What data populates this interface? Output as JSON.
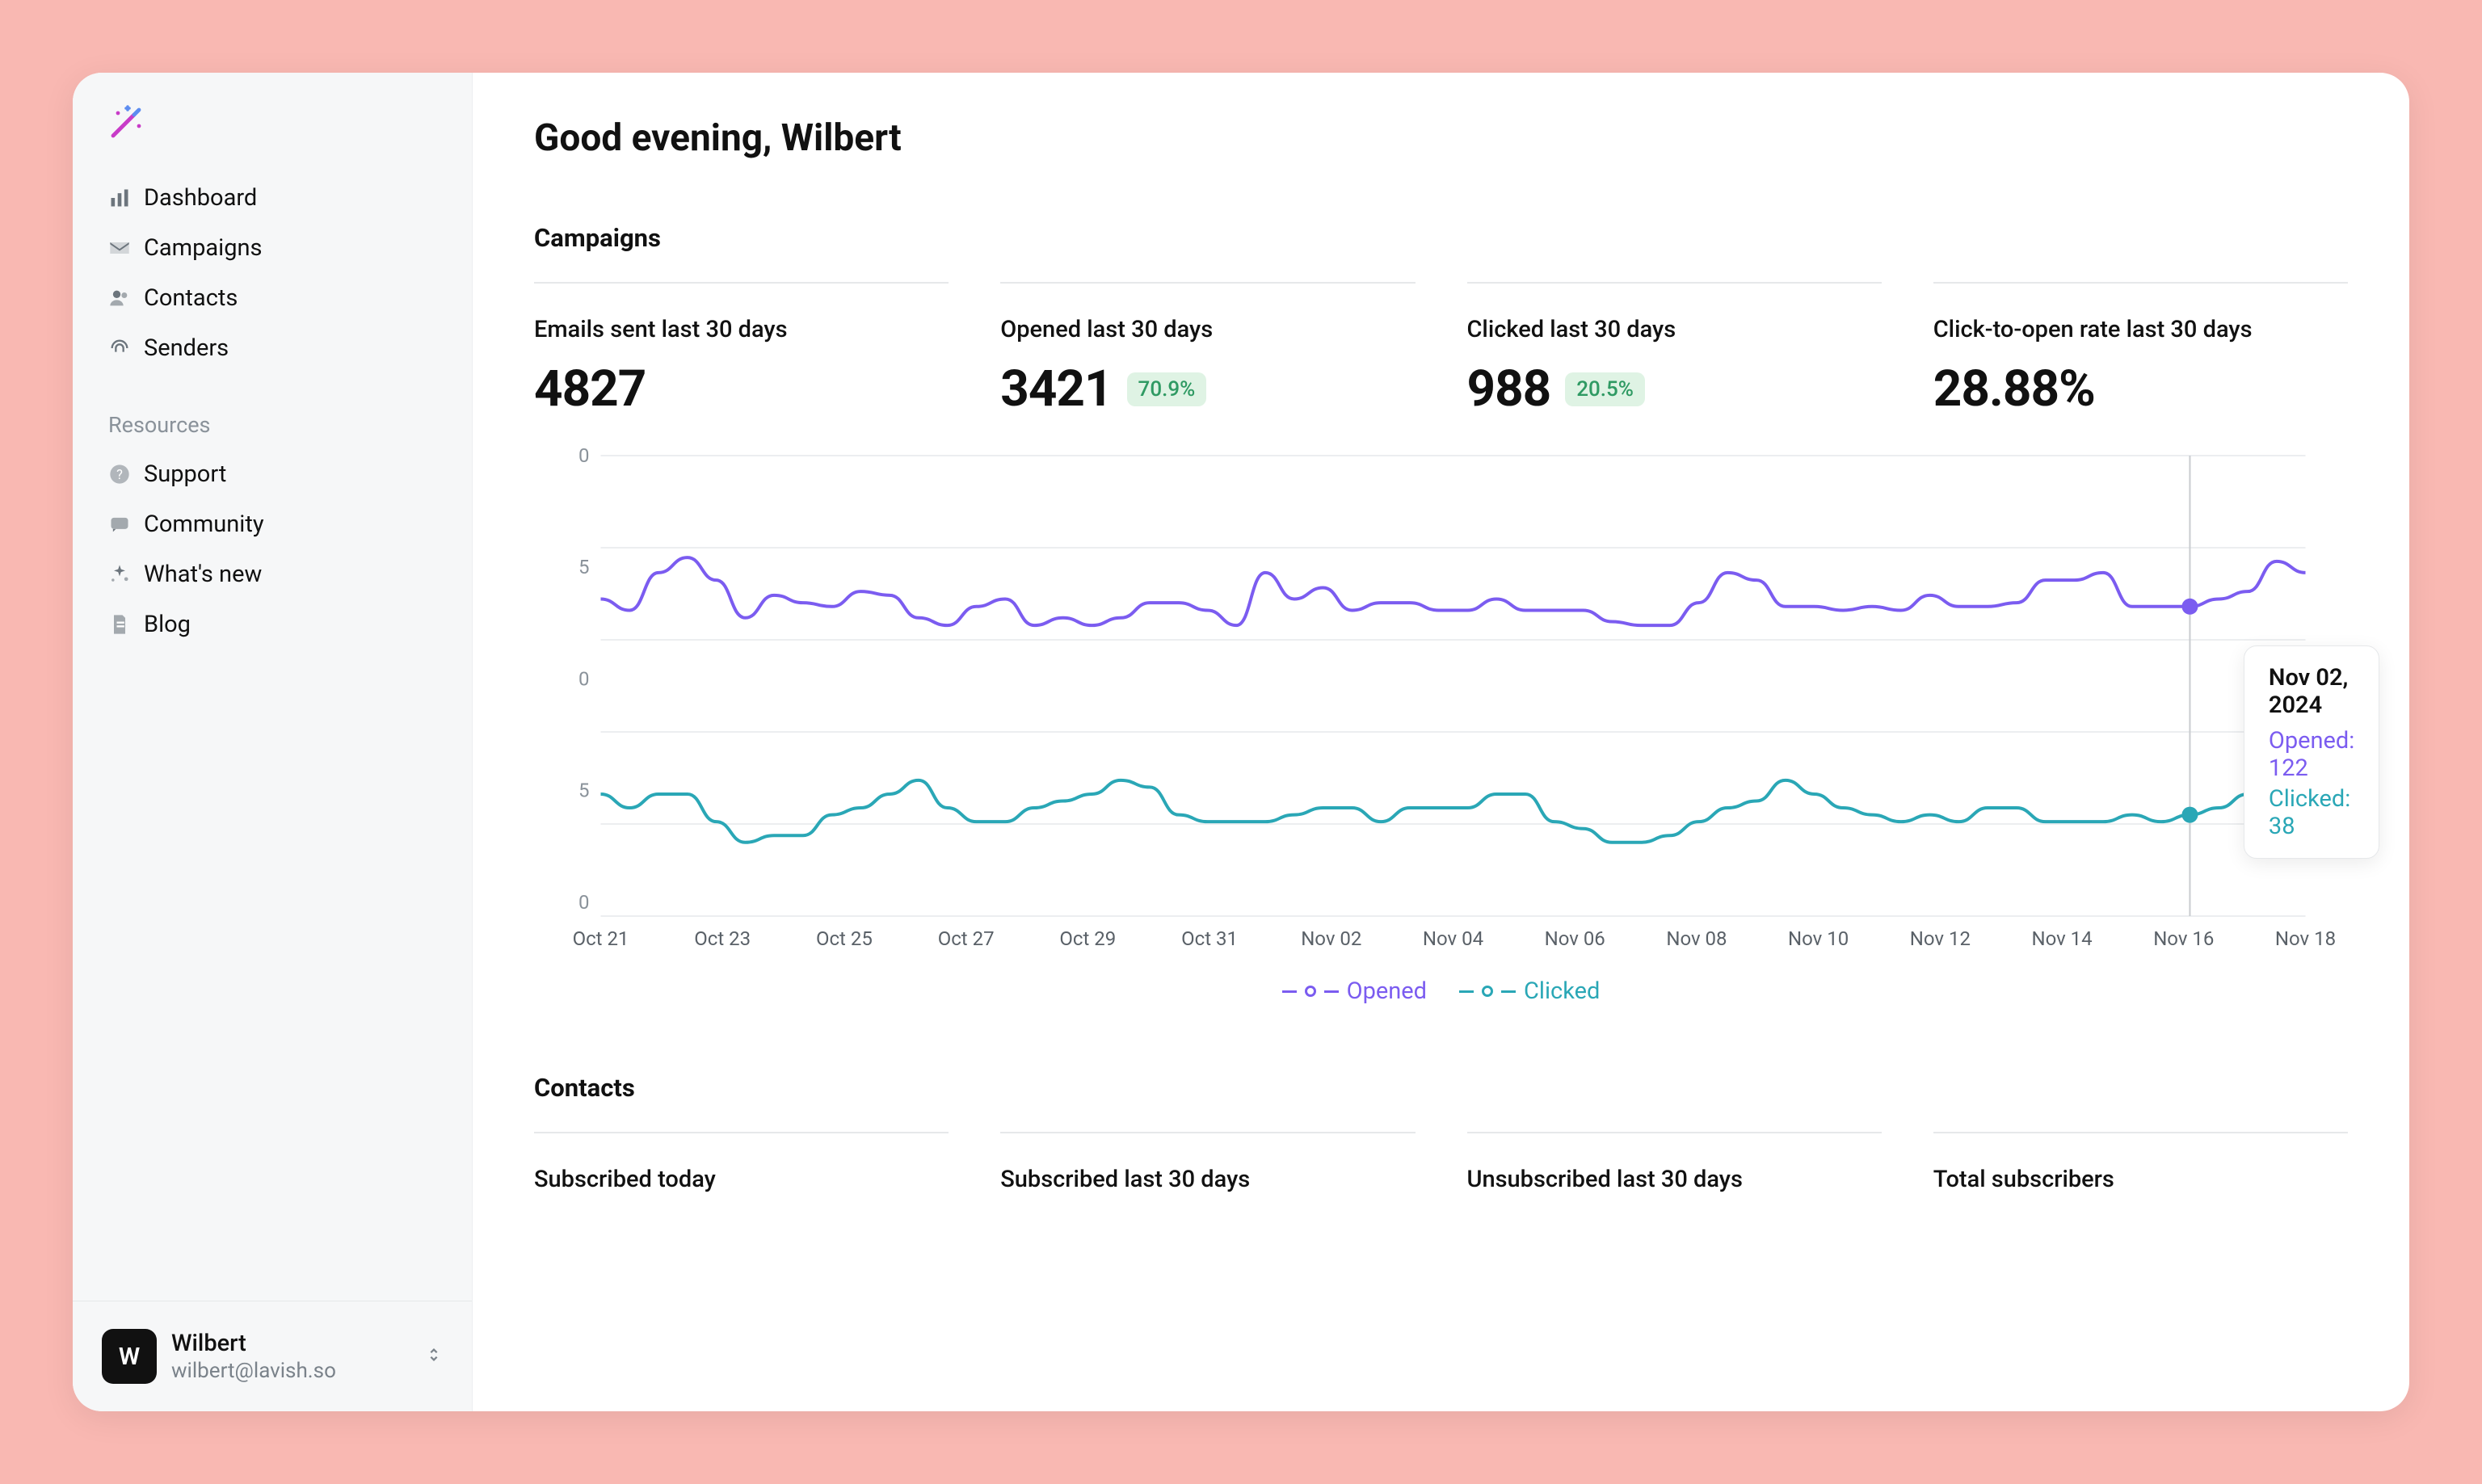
{
  "sidebar": {
    "nav": [
      {
        "label": "Dashboard",
        "icon": "bar-chart-icon"
      },
      {
        "label": "Campaigns",
        "icon": "envelope-icon"
      },
      {
        "label": "Contacts",
        "icon": "users-icon"
      },
      {
        "label": "Senders",
        "icon": "fingerprint-icon"
      }
    ],
    "resources_label": "Resources",
    "resources": [
      {
        "label": "Support",
        "icon": "help-icon"
      },
      {
        "label": "Community",
        "icon": "chat-icon"
      },
      {
        "label": "What's new",
        "icon": "sparkles-icon"
      },
      {
        "label": "Blog",
        "icon": "document-icon"
      }
    ],
    "user": {
      "initial": "W",
      "name": "Wilbert",
      "email": "wilbert@lavish.so"
    }
  },
  "page_title": "Good evening, Wilbert",
  "campaigns": {
    "title": "Campaigns",
    "stats": [
      {
        "label": "Emails sent last 30 days",
        "value": "4827",
        "badge": null
      },
      {
        "label": "Opened last 30 days",
        "value": "3421",
        "badge": "70.9%"
      },
      {
        "label": "Clicked last 30 days",
        "value": "988",
        "badge": "20.5%"
      },
      {
        "label": "Click-to-open rate last 30 days",
        "value": "28.88%",
        "badge": null
      }
    ]
  },
  "chart_data": {
    "type": "line",
    "x_ticks": [
      "Oct 21",
      "Oct 23",
      "Oct 25",
      "Oct 27",
      "Oct 29",
      "Oct 31",
      "Nov 02",
      "Nov 04",
      "Nov 06",
      "Nov 08",
      "Nov 10",
      "Nov 12",
      "Nov 14",
      "Nov 16",
      "Nov 18"
    ],
    "y_ticks_top": [
      0,
      5
    ],
    "y_ticks_bottom": [
      0,
      5,
      0
    ],
    "series": [
      {
        "name": "Opened",
        "color": "#7b5cf0",
        "values": [
          115,
          112,
          122,
          126,
          120,
          110,
          116,
          114,
          113,
          117,
          116,
          110,
          108,
          113,
          115,
          108,
          110,
          108,
          110,
          114,
          114,
          112,
          108,
          122,
          115,
          118,
          112,
          114,
          114,
          112,
          112,
          115,
          112,
          112,
          112,
          109,
          108,
          108,
          114,
          122,
          120,
          113,
          113,
          112,
          113,
          112,
          116,
          113,
          113,
          114,
          120,
          120,
          122,
          113,
          113,
          113,
          115,
          117,
          125,
          122
        ],
        "note": "values read approximately from curve; x spans Oct 20 → Nov 18 at half-day resolution"
      },
      {
        "name": "Clicked",
        "color": "#2aa7b6",
        "values": [
          40,
          38,
          40,
          40,
          36,
          33,
          34,
          34,
          37,
          38,
          40,
          42,
          38,
          36,
          36,
          38,
          39,
          40,
          42,
          41,
          37,
          36,
          36,
          36,
          37,
          38,
          38,
          36,
          38,
          38,
          38,
          40,
          40,
          36,
          35,
          33,
          33,
          34,
          36,
          38,
          39,
          42,
          40,
          38,
          37,
          36,
          37,
          36,
          38,
          38,
          36,
          36,
          36,
          37,
          36,
          37,
          38,
          40,
          42,
          43
        ],
        "note": "values read approximately from curve"
      }
    ],
    "tooltip": {
      "date": "Nov 02, 2024",
      "opened_label": "Opened: 122",
      "clicked_label": "Clicked: 38",
      "x_index": 13
    },
    "legend": [
      {
        "name": "Opened",
        "color": "#7b5cf0"
      },
      {
        "name": "Clicked",
        "color": "#2aa7b6"
      }
    ]
  },
  "contacts": {
    "title": "Contacts",
    "stats": [
      {
        "label": "Subscribed today"
      },
      {
        "label": "Subscribed last 30 days"
      },
      {
        "label": "Unsubscribed last 30 days"
      },
      {
        "label": "Total subscribers"
      }
    ]
  },
  "colors": {
    "accent_purple": "#c83cc8",
    "accent_blue": "#5c8cf0"
  }
}
